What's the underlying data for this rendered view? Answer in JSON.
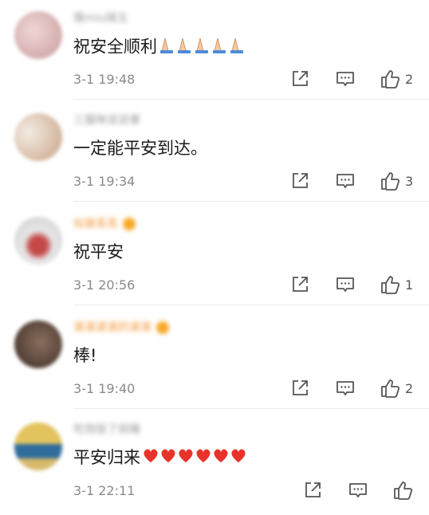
{
  "comments": [
    {
      "username": "薇miu瑞玉",
      "name_style": "gray",
      "vip": false,
      "text": "祝安全顺利",
      "emoji": "pray",
      "emoji_count": 5,
      "time": "3-1 19:48",
      "likes": "2",
      "avatar_colors": [
        "#e8c9c9",
        "#c9a1a1"
      ]
    },
    {
      "username": "三猫咪说说事",
      "name_style": "gray",
      "vip": false,
      "text": "一定能平安到达。",
      "emoji": "",
      "emoji_count": 0,
      "time": "3-1 19:34",
      "likes": "3",
      "avatar_colors": [
        "#efe3d6",
        "#c9a98a"
      ]
    },
    {
      "username": "似玻丢丢",
      "name_style": "orange",
      "vip": true,
      "text": "祝平安",
      "emoji": "",
      "emoji_count": 0,
      "time": "3-1 20:56",
      "likes": "1",
      "avatar_colors": [
        "#dcdcdc",
        "#c44848"
      ]
    },
    {
      "username": "滚滚滚滚的滚滚",
      "name_style": "orange",
      "vip": true,
      "text": "棒!",
      "emoji": "",
      "emoji_count": 0,
      "time": "3-1 19:40",
      "likes": "2",
      "avatar_colors": [
        "#6b5448",
        "#3a2c24"
      ]
    },
    {
      "username": "吃饱饭了就睡",
      "name_style": "gray",
      "vip": false,
      "text": "平安归来",
      "emoji": "heart",
      "emoji_count": 6,
      "time": "3-1 22:11",
      "likes": "",
      "avatar_colors": [
        "#e3c35e",
        "#2f6c9c"
      ]
    }
  ],
  "icons": {
    "share": "share-icon",
    "reply": "comment-icon",
    "like": "thumbs-up-icon"
  },
  "colors": {
    "vip_name": "#f29633",
    "normal_name": "#9a9a9a",
    "heart": "#e8332b",
    "time": "#8a8a8a"
  }
}
